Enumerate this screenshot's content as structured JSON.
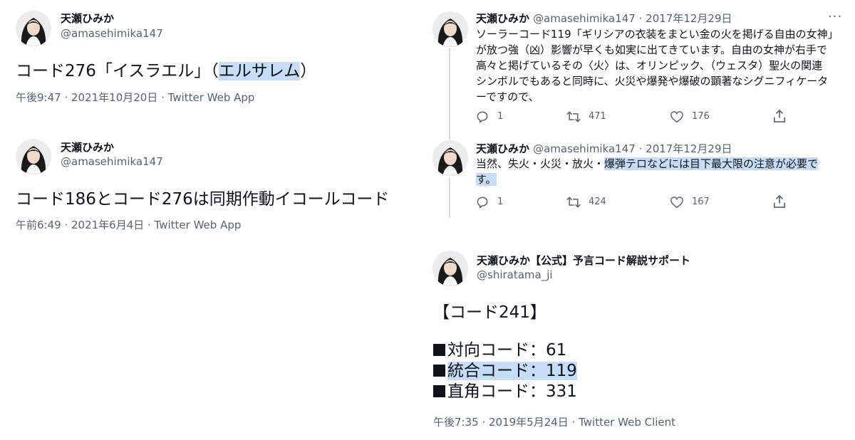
{
  "tweet1": {
    "name": "天瀬ひみか",
    "handle": "@amasehimika147",
    "text_before": "コード276「イスラエル」（",
    "text_highlight": "エルサレム",
    "text_after": "）",
    "meta": "午後9:47 · 2021年10月20日 · Twitter Web App"
  },
  "tweet2": {
    "name": "天瀬ひみか",
    "handle": "@amasehimika147",
    "text": "コード186とコード276は同期作動イコールコード",
    "meta": "午前6:49 · 2021年6月4日 · Twitter Web App"
  },
  "tweet3": {
    "name": "天瀬ひみか",
    "handle_date": "@amasehimika147 · 2017年12月29日",
    "lines": [
      "ソーラーコード119「ギリシアの衣装をまとい金の火を掲げる自由の女神」",
      "が放つ強（凶）影響が早くも如実に出てきています。自由の女神が右手で",
      "高々と掲げているその〈火〉は、オリンピック、（ウェスタ）聖火の関連",
      "シンボルでもあると同時に、火災や爆発や爆破の顕著なシグニフィケータ",
      "ーですので、"
    ],
    "replies": "1",
    "retweets": "471",
    "likes": "176",
    "more": "···"
  },
  "tweet4": {
    "name": "天瀬ひみか",
    "handle_date": "@amasehimika147 · 2017年12月29日",
    "line1_plain": "当然、失火・火災・放火・",
    "line1_highlight": "爆弾テロなどには目下最大限の注意が必要で",
    "line2_highlight": "す。",
    "replies": "1",
    "retweets": "424",
    "likes": "167"
  },
  "tweet5": {
    "name": "天瀬ひみか【公式】予言コード解説サポート",
    "handle": "@shiratama_ji",
    "heading": "【コード241】",
    "items": [
      {
        "label": "対向コード：61",
        "highlight": false
      },
      {
        "label": "統合コード：119",
        "highlight": true
      },
      {
        "label": "直角コード：331",
        "highlight": false
      }
    ],
    "meta": "午後7:35 · 2019年5月24日 · Twitter Web Client"
  },
  "colors": {
    "text": "#0f1419",
    "secondary": "#536471",
    "highlight": "#c6dcf7",
    "thread_line": "#cfd9de"
  },
  "icons": [
    "reply-icon",
    "retweet-icon",
    "like-icon",
    "share-icon",
    "more-icon"
  ]
}
